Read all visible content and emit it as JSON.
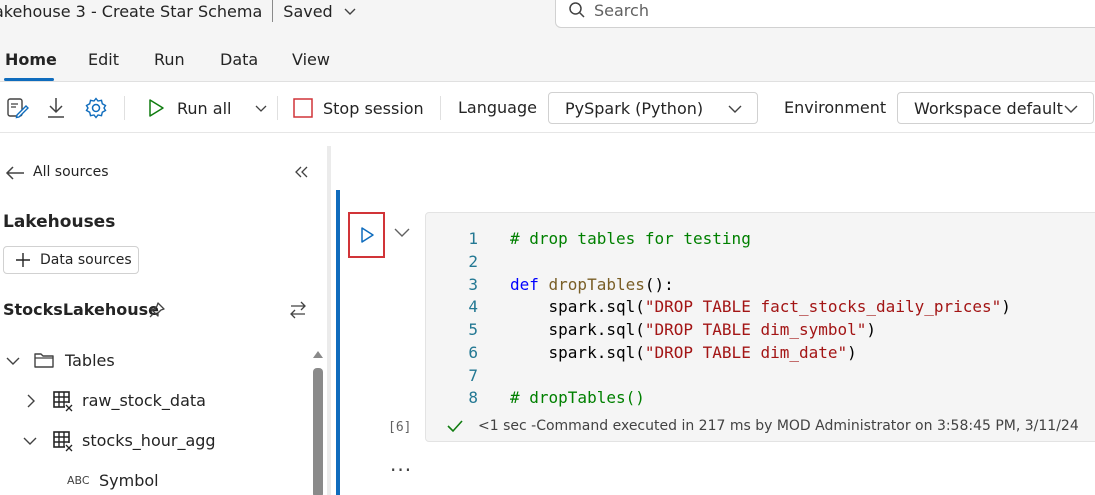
{
  "window": {
    "title": "akehouse 3 - Create Star Schema",
    "save_state": "Saved"
  },
  "search": {
    "placeholder": "Search"
  },
  "menu_tabs": [
    {
      "label": "Home",
      "active": true
    },
    {
      "label": "Edit"
    },
    {
      "label": "Run"
    },
    {
      "label": "Data"
    },
    {
      "label": "View"
    }
  ],
  "toolbar": {
    "icons": [
      "edit-icon",
      "download-icon",
      "settings-icon"
    ],
    "run_all": "Run all",
    "stop_session": "Stop session",
    "language_label": "Language",
    "language_value": "PySpark (Python)",
    "environment_label": "Environment",
    "environment_value": "Workspace default"
  },
  "explorer": {
    "back_label": "All sources",
    "heading": "Lakehouses",
    "data_sources_button": "Data sources",
    "lakehouse_name": "StocksLakehouse",
    "tree": {
      "tables_label": "Tables",
      "items": [
        {
          "label": "raw_stock_data",
          "expanded": false
        },
        {
          "label": "stocks_hour_agg",
          "expanded": true
        }
      ],
      "column": {
        "type": "ABC",
        "name": "Symbol"
      }
    }
  },
  "cell": {
    "execution_count": "[6]",
    "lines": [
      {
        "n": "1",
        "tokens": [
          {
            "t": "# drop tables for testing",
            "c": "com"
          }
        ]
      },
      {
        "n": "2",
        "tokens": []
      },
      {
        "n": "3",
        "tokens": [
          {
            "t": "def ",
            "c": "kw"
          },
          {
            "t": "dropTables",
            "c": "fn"
          },
          {
            "t": "():",
            "c": "txt"
          }
        ]
      },
      {
        "n": "4",
        "tokens": [
          {
            "t": "    spark.sql(",
            "c": "txt"
          },
          {
            "t": "\"DROP TABLE fact_stocks_daily_prices\"",
            "c": "str"
          },
          {
            "t": ")",
            "c": "txt"
          }
        ]
      },
      {
        "n": "5",
        "tokens": [
          {
            "t": "    spark.sql(",
            "c": "txt"
          },
          {
            "t": "\"DROP TABLE dim_symbol\"",
            "c": "str"
          },
          {
            "t": ")",
            "c": "txt"
          }
        ]
      },
      {
        "n": "6",
        "tokens": [
          {
            "t": "    spark.sql(",
            "c": "txt"
          },
          {
            "t": "\"DROP TABLE dim_date\"",
            "c": "str"
          },
          {
            "t": ")",
            "c": "txt"
          }
        ]
      },
      {
        "n": "7",
        "tokens": []
      },
      {
        "n": "8",
        "tokens": [
          {
            "t": "# dropTables()",
            "c": "com"
          }
        ]
      }
    ],
    "status_text": "<1 sec -Command executed in 217 ms by MOD Administrator on 3:58:45 PM, 3/11/24",
    "more_label": "..."
  },
  "colors": {
    "accent": "#0f6cbd",
    "run_all_green": "#107c10",
    "stop_red": "#d13438",
    "highlight_box": "#d13438"
  }
}
